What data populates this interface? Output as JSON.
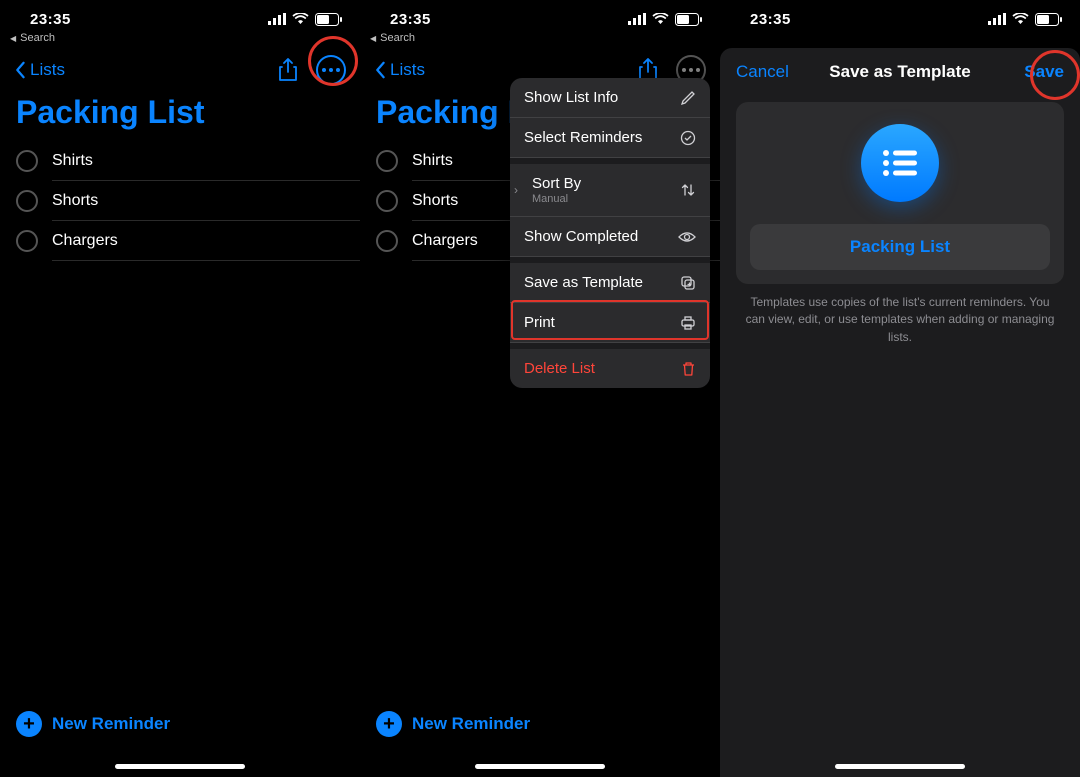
{
  "status": {
    "time": "23:35",
    "back_app": "Search"
  },
  "nav": {
    "back_label": "Lists"
  },
  "list": {
    "title": "Packing List",
    "items": [
      "Shirts",
      "Shorts",
      "Chargers"
    ]
  },
  "footer": {
    "new_reminder": "New Reminder"
  },
  "menu": {
    "show_info": "Show List Info",
    "select": "Select Reminders",
    "sort_by": "Sort By",
    "sort_value": "Manual",
    "show_completed": "Show Completed",
    "save_template": "Save as Template",
    "print": "Print",
    "delete": "Delete List"
  },
  "modal": {
    "cancel": "Cancel",
    "title": "Save as Template",
    "save": "Save",
    "template_name": "Packing List",
    "description": "Templates use copies of the list's current reminders. You can view, edit, or use templates when adding or managing lists."
  }
}
